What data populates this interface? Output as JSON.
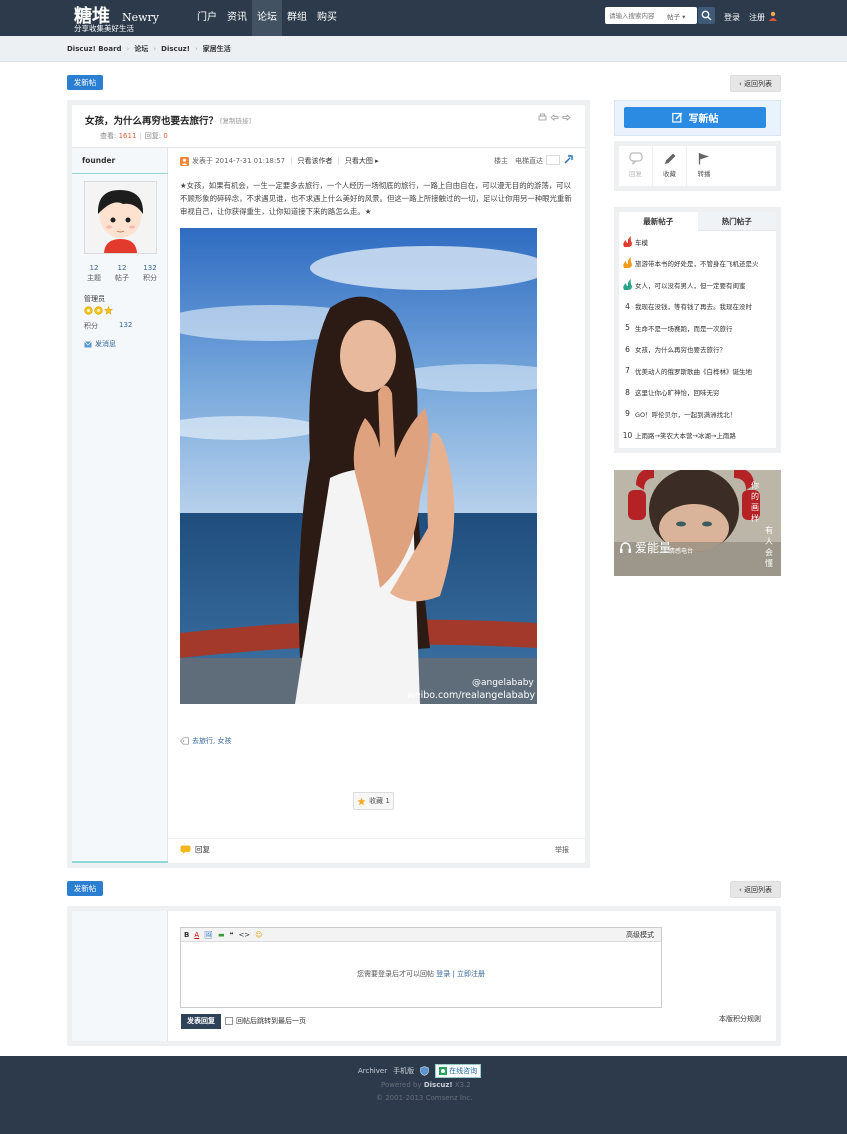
{
  "header": {
    "logo_main": "糖堆",
    "logo_en": "Newry",
    "logo_slogan": "分享收集美好生活",
    "nav": [
      "门户",
      "资讯",
      "论坛",
      "群组",
      "购买"
    ],
    "nav_active": "论坛",
    "search_placeholder": "请输入搜索内容",
    "search_type": "帖子",
    "login": "登录",
    "register": "注册"
  },
  "breadcrumb": [
    "Discuz! Board",
    "论坛",
    "Discuz!",
    "家居生活"
  ],
  "buttons": {
    "new_post": "发新帖",
    "back_to_list": "返回列表"
  },
  "thread": {
    "title": "女孩，为什么再穷也要去旅行？",
    "copy_link": "[复制链接]",
    "views_label": "查看:",
    "views": "1611",
    "replies_label": "回复:",
    "replies": "0"
  },
  "author": {
    "name": "founder",
    "stats": [
      {
        "value": "12",
        "label": "主题"
      },
      {
        "value": "12",
        "label": "帖子"
      },
      {
        "value": "132",
        "label": "积分"
      }
    ],
    "rank": "管理员",
    "credits_label": "积分",
    "credits": "132",
    "send_message": "发消息"
  },
  "post": {
    "posted_at": "发表于 2014-7-31 01:18:57",
    "only_author": "只看该作者",
    "only_large_image": "只看大图",
    "floor": "楼主",
    "jump_label": "电梯直达",
    "text": "★女孩，如果有机会，一生一定要多去旅行，一个人经历一场彻底的旅行，一路上自由自在，可以漫无目的的游荡，可以不顾形象的碎碎念，不求遇见谁，也不求遇上什么美好的风景。但这一路上所接触过的一切，足以让你用另一种眼光重新审视自己，让你获得重生，让你知道接下来的路怎么走。★",
    "watermark_1": "@angelababy",
    "watermark_2": "weibo.com/realangelababy",
    "tags": "去旅行, 女孩",
    "favorite": "收藏 1",
    "reply": "回复",
    "report": "举报"
  },
  "sidebar": {
    "new_post": "写新帖",
    "actions": [
      {
        "icon": "reply-bubble-icon",
        "label": "回复"
      },
      {
        "icon": "pencil-icon",
        "label": "收藏"
      },
      {
        "icon": "flag-icon",
        "label": "转播"
      }
    ],
    "tabs": [
      "最新帖子",
      "热门帖子"
    ],
    "hot_posts": [
      {
        "rank": "",
        "medal": "#e23b2e",
        "title": "车模"
      },
      {
        "rank": "",
        "medal": "#f29b1a",
        "title": "旅游带本书的好处是，不管身在飞机还是火"
      },
      {
        "rank": "",
        "medal": "#2aa58a",
        "title": "女人，可以没有男人，但一定要有闺蜜"
      },
      {
        "rank": "4",
        "title": "我现在没钱，等有钱了再去。我现在没时"
      },
      {
        "rank": "5",
        "title": "生命不是一场赛跑，而是一次旅行"
      },
      {
        "rank": "6",
        "title": "女孩，为什么再穷也要去旅行？"
      },
      {
        "rank": "7",
        "title": "优美动人的俄罗斯歌曲《白桦林》诞生地"
      },
      {
        "rank": "8",
        "title": "这里让你心旷神怡，回味无穷"
      },
      {
        "rank": "9",
        "title": "GO！呼伦贝尔，一起到满洲找北！"
      },
      {
        "rank": "10",
        "title": "上雨路→笑农大本营→冰湖→上雨路"
      }
    ],
    "ad": {
      "logo": "爱能量",
      "sub": "情感电台",
      "side_1": "你的画样",
      "side_2": "有人会懂"
    }
  },
  "reply_box": {
    "toolbar": [
      "B",
      "A",
      "🖼",
      "▬",
      "❝",
      "<>",
      "☺"
    ],
    "advanced_mode": "高级模式",
    "hint_prefix": "您需要登录后才可以回帖",
    "hint_login": "登录",
    "hint_sep": "|",
    "hint_register": "立即注册",
    "submit": "发表回复",
    "go_last_page": "回帖后跳转到最后一页",
    "credit_rule": "本版积分规则"
  },
  "footer": {
    "archiver": "Archiver",
    "mobile": "手机版",
    "online": "在线咨询",
    "powered_by": "Powered by",
    "brand": "Discuz!",
    "version": "X3.2",
    "copyright": "© 2001-2013 Comsenz Inc."
  }
}
